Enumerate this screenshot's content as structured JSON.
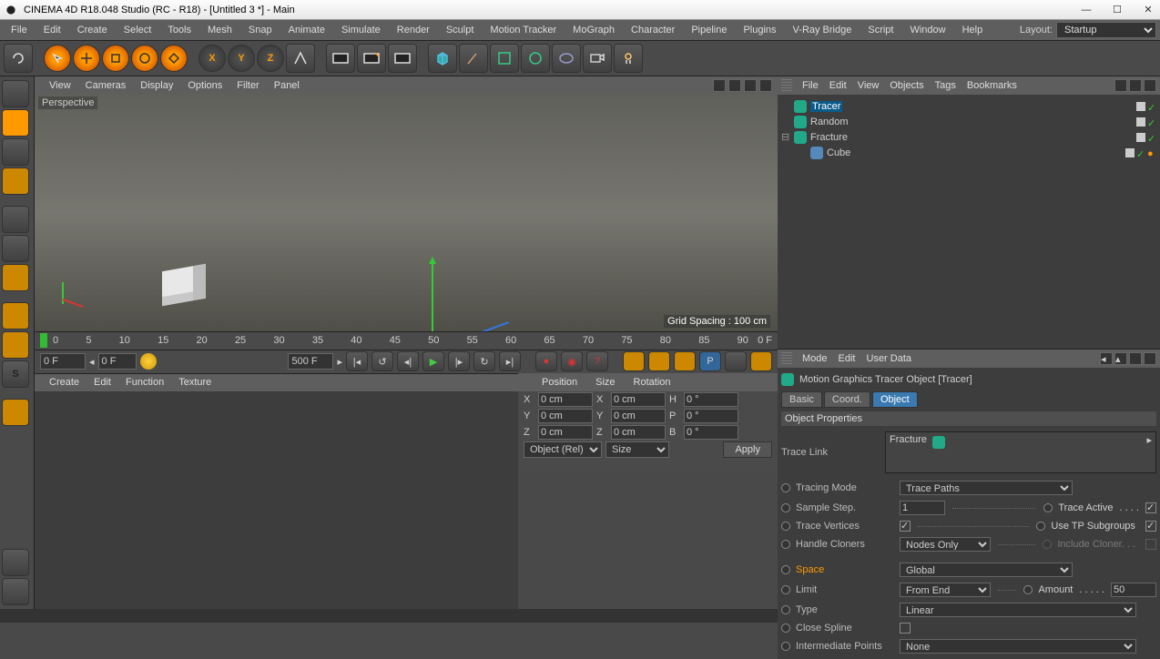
{
  "title": "CINEMA 4D R18.048 Studio (RC - R18) - [Untitled 3 *] - Main",
  "menubar": [
    "File",
    "Edit",
    "Create",
    "Select",
    "Tools",
    "Mesh",
    "Snap",
    "Animate",
    "Simulate",
    "Render",
    "Sculpt",
    "Motion Tracker",
    "MoGraph",
    "Character",
    "Pipeline",
    "Plugins",
    "V-Ray Bridge",
    "Script",
    "Window",
    "Help"
  ],
  "layout_label": "Layout:",
  "layout_value": "Startup",
  "viewport_menubar": [
    "View",
    "Cameras",
    "Display",
    "Options",
    "Filter",
    "Panel"
  ],
  "viewport_label": "Perspective",
  "grid_spacing": "Grid Spacing : 100 cm",
  "timeline": {
    "ticks": [
      "0",
      "5",
      "10",
      "15",
      "20",
      "25",
      "30",
      "35",
      "40",
      "45",
      "50",
      "55",
      "60",
      "65",
      "70",
      "75",
      "80",
      "85",
      "90"
    ],
    "start": "0 F",
    "cur": "0 F",
    "end": "500 F",
    "end2": "0 F"
  },
  "material_menu": [
    "Create",
    "Edit",
    "Function",
    "Texture"
  ],
  "coord": {
    "headers": [
      "Position",
      "Size",
      "Rotation"
    ],
    "axes": [
      "X",
      "Y",
      "Z"
    ],
    "pos": [
      "0 cm",
      "0 cm",
      "0 cm"
    ],
    "size": [
      "0 cm",
      "0 cm",
      "0 cm"
    ],
    "rotlbl": [
      "H",
      "P",
      "B"
    ],
    "rot": [
      "0 °",
      "0 °",
      "0 °"
    ],
    "objrel": "Object (Rel)",
    "sizemode": "Size",
    "apply": "Apply"
  },
  "objmgr": {
    "menu": [
      "File",
      "Edit",
      "View",
      "Objects",
      "Tags",
      "Bookmarks"
    ],
    "rows": [
      {
        "indent": 0,
        "exp": "",
        "icon": "tracer",
        "label": "Tracer",
        "sel": true
      },
      {
        "indent": 0,
        "exp": "",
        "icon": "random",
        "label": "Random",
        "sel": false
      },
      {
        "indent": 0,
        "exp": "–",
        "icon": "fracture",
        "label": "Fracture",
        "sel": false
      },
      {
        "indent": 1,
        "exp": "",
        "icon": "cube",
        "label": "Cube",
        "sel": false
      }
    ]
  },
  "attrs": {
    "menu": [
      "Mode",
      "Edit",
      "User Data"
    ],
    "title": "Motion Graphics Tracer Object [Tracer]",
    "tabs": [
      "Basic",
      "Coord.",
      "Object"
    ],
    "active_tab": 2,
    "section": "Object Properties",
    "tracelink_label": "Trace Link",
    "tracelink_value": "Fracture",
    "rows": [
      {
        "label": "Tracing Mode",
        "type": "select",
        "value": "Trace Paths",
        "full": true
      },
      {
        "label": "Sample Step.",
        "type": "num",
        "value": "1",
        "right": {
          "label": "Trace Active",
          "type": "chk",
          "on": true
        }
      },
      {
        "label": "Trace Vertices",
        "type": "chk",
        "on": true,
        "right": {
          "label": "Use TP Subgroups",
          "type": "chk",
          "on": true
        }
      },
      {
        "label": "Handle Cloners",
        "type": "select",
        "value": "Nodes Only",
        "right": {
          "label": "Include Cloner. . .",
          "type": "chk",
          "on": false,
          "dim": true
        }
      },
      {
        "label": "Space",
        "type": "select",
        "value": "Global",
        "full": true,
        "orange": true
      },
      {
        "label": "Limit",
        "type": "select",
        "value": "From End",
        "right": {
          "label": "Amount",
          "type": "num",
          "value": "50"
        }
      },
      {
        "label": "Type",
        "type": "select",
        "value": "Linear",
        "full": true,
        "wider": true
      },
      {
        "label": "Close Spline",
        "type": "chk",
        "on": false
      },
      {
        "label": "Intermediate Points",
        "type": "select",
        "value": "None",
        "full": true
      }
    ]
  }
}
